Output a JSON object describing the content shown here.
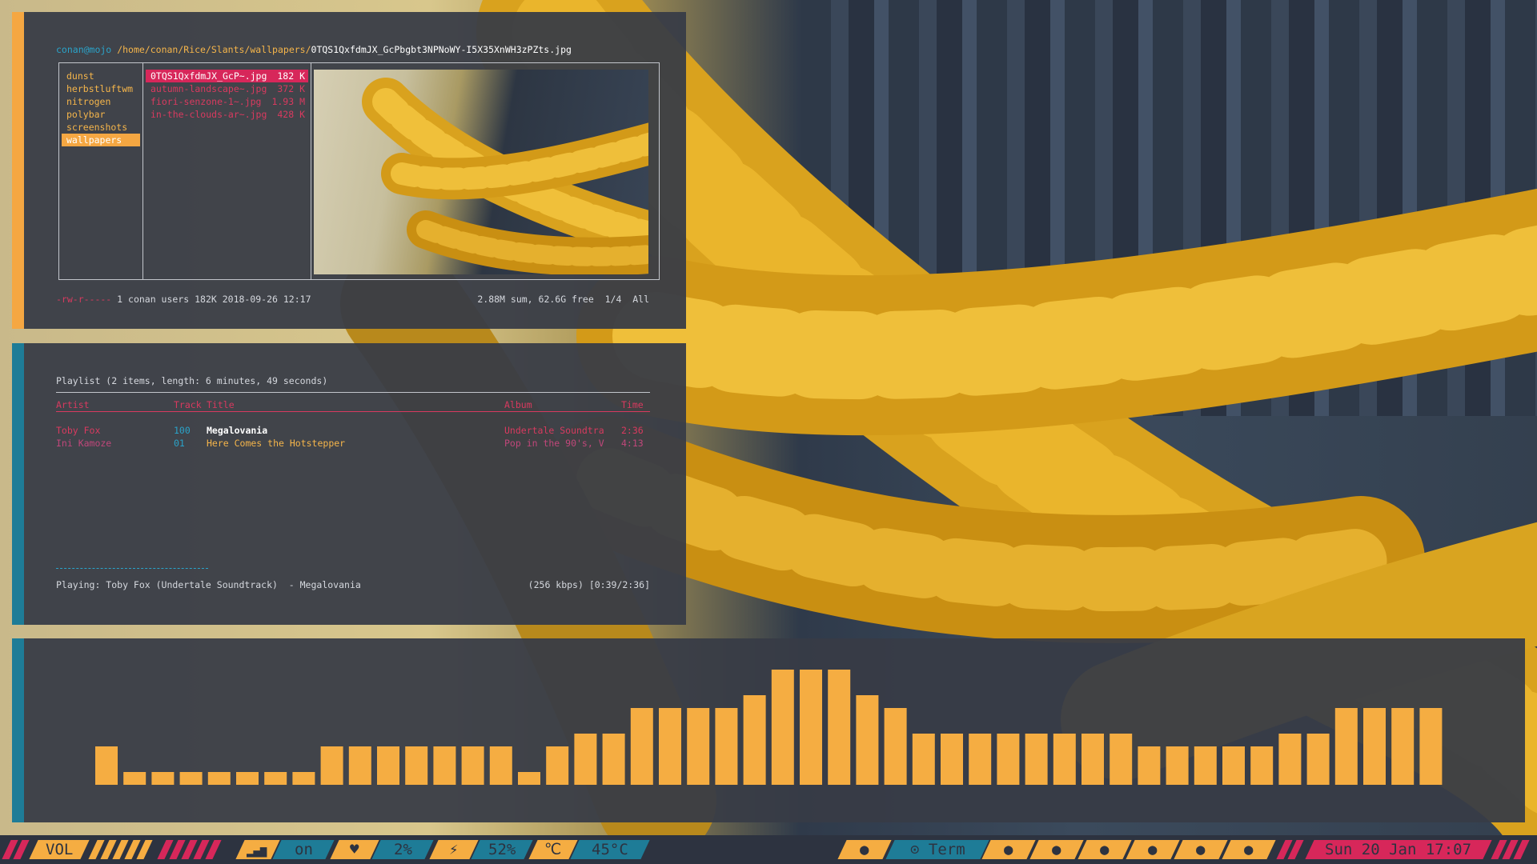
{
  "ranger": {
    "user": "conan@mojo",
    "dir": "/home/conan/Rice/Slants/wallpapers/",
    "file": "0TQS1QxfdmJX_GcPbgbt3NPNoWY-I5X35XnWH3zPZts.jpg",
    "dirs": [
      "dunst",
      "herbstluftwm",
      "nitrogen",
      "polybar",
      "screenshots",
      "wallpapers"
    ],
    "selected_dir": 5,
    "files": [
      {
        "name": "0TQS1QxfdmJX_GcP~.jpg",
        "size": "182 K"
      },
      {
        "name": "autumn-landscape~.jpg",
        "size": "372 K"
      },
      {
        "name": "fiori-senzone-1~.jpg",
        "size": "1.93 M"
      },
      {
        "name": "in-the-clouds-ar~.jpg",
        "size": "428 K"
      }
    ],
    "status_perm": "-rw-r-----",
    "status_info": " 1 conan users 182K 2018-09-26 12:17",
    "status_right": "2.88M sum, 62.6G free  1/4  All"
  },
  "cmus": {
    "title": "Playlist (2 items, length: 6 minutes, 49 seconds)",
    "headers": {
      "artist": "Artist",
      "track": "Track",
      "title": "Title",
      "album": "Album",
      "time": "Time"
    },
    "rows": [
      {
        "artist": "Toby Fox",
        "track": "100",
        "title": "Megalovania",
        "album": "Undertale Soundtra",
        "time": "2:36"
      },
      {
        "artist": "Ini Kamoze",
        "track": "01",
        "title": "Here Comes the Hotstepper",
        "album": "Pop in the 90's, V",
        "time": "4:13"
      }
    ],
    "playing": "Playing: Toby Fox (Undertale Soundtrack)  - Megalovania",
    "playing_right": "(256 kbps) [0:39/2:36]"
  },
  "visualizer": {
    "color": "#f5ad42",
    "bars": [
      3,
      1,
      1,
      1,
      1,
      1,
      1,
      1,
      3,
      3,
      3,
      3,
      3,
      3,
      3,
      1,
      3,
      4,
      4,
      6,
      6,
      6,
      6,
      7,
      9,
      9,
      9,
      7,
      6,
      4,
      4,
      4,
      4,
      4,
      4,
      4,
      4,
      3,
      3,
      3,
      3,
      3,
      4,
      4,
      6,
      6,
      6,
      6
    ]
  },
  "polybar": {
    "vol_label": "VOL",
    "wifi_status": "on",
    "cpu": "2%",
    "battery": "52%",
    "temp": "45°C",
    "term_label": "Term",
    "datetime": "Sun 20 Jan 17:07",
    "colors": {
      "orange": "#f5ad42",
      "pink": "#d7275a",
      "teal": "#1e7c97",
      "dark": "#2d3340"
    }
  }
}
